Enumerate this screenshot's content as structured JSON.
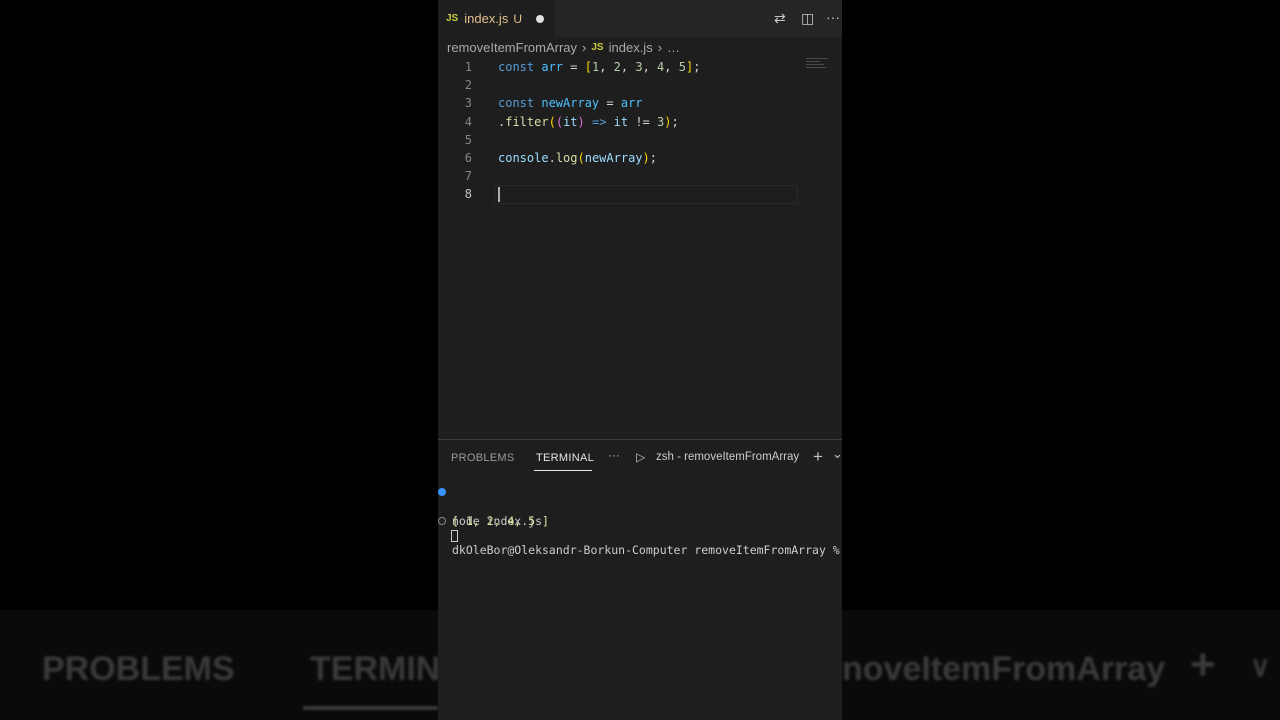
{
  "background": {
    "blur_texts": [
      "PROBLEMS",
      "TERMIN",
      "noveItemFromArray",
      "+",
      "∨"
    ]
  },
  "tab": {
    "lang_badge": "JS",
    "filename": "index.js",
    "status": "U"
  },
  "toolbar": {
    "compare_icon": "⇄",
    "split_icon": "◫",
    "more_icon": "···"
  },
  "breadcrumb": {
    "folder": "removeItemFromArray",
    "sep": "›",
    "lang_badge": "JS",
    "file": "index.js",
    "ellipsis": "…"
  },
  "code": {
    "line_numbers": [
      "1",
      "2",
      "3",
      "4",
      "5",
      "6",
      "7",
      "8"
    ],
    "l1": {
      "kw": "const",
      "name": "arr",
      "eq": " = ",
      "open": "[",
      "n1": "1",
      "c1": ", ",
      "n2": "2",
      "c2": ", ",
      "n3": "3",
      "c3": ", ",
      "n4": "4",
      "c4": ", ",
      "n5": "5",
      "close": "]",
      "semi": ";"
    },
    "l3": {
      "kw": "const",
      "name": "newArray",
      "eq": " = ",
      "ref": "arr"
    },
    "l4": {
      "dot": ".",
      "fn": "filter",
      "open": "(",
      "popen": "(",
      "param": "it",
      "pclose": ")",
      "arrow": " => ",
      "ref": "it",
      "op": " != ",
      "num": "3",
      "close": ")",
      "semi": ";"
    },
    "l6": {
      "obj": "console",
      "dot": ".",
      "fn": "log",
      "open": "(",
      "arg": "newArray",
      "close": ")",
      "semi": ";"
    }
  },
  "panel": {
    "tabs": [
      "PROBLEMS",
      "TERMINAL"
    ],
    "more": "···",
    "shell_icon": "▷",
    "shell_name": "zsh - removeItemFromArray",
    "add": "+",
    "chevron": "⌄"
  },
  "terminal": {
    "cmd": "node index.js",
    "output": "[ 1, 2, 4, 5 ]",
    "prompt": "dkOleBor@Oleksandr-Borkun-Computer removeItemFromArray %",
    "dot_success": "#3794ff",
    "dot_idle": "#8a8a8a"
  }
}
